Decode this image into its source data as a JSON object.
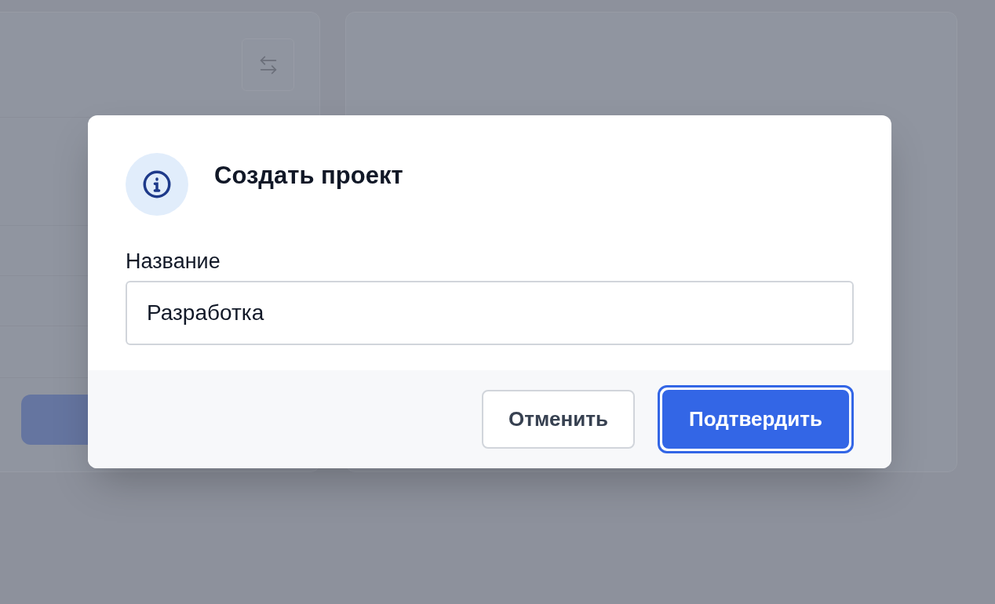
{
  "dialog": {
    "title": "Создать проект",
    "field": {
      "label": "Название",
      "value": "Разработка"
    },
    "buttons": [
      {
        "label": "Отменить",
        "kind": "secondary",
        "focused": false
      },
      {
        "label": "Подтвердить",
        "kind": "primary",
        "focused": true
      }
    ]
  }
}
